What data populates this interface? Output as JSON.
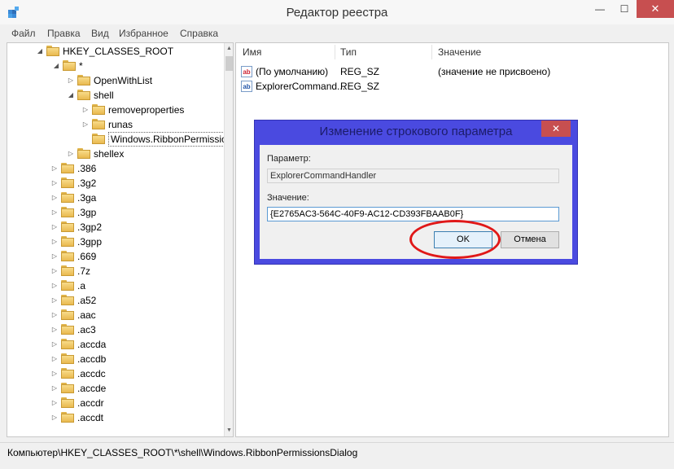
{
  "window": {
    "title": "Редактор реестра",
    "minimize_glyph": "—",
    "maximize_glyph": "☐",
    "close_glyph": "✕"
  },
  "menu": [
    "Файл",
    "Правка",
    "Вид",
    "Избранное",
    "Справка"
  ],
  "tree": [
    {
      "label": "HKEY_CLASSES_ROOT",
      "expanded": true
    },
    {
      "label": "*",
      "expanded": true
    },
    {
      "label": "OpenWithList",
      "expanded": false
    },
    {
      "label": "shell",
      "expanded": true
    },
    {
      "label": "removeproperties",
      "expanded": false
    },
    {
      "label": "runas",
      "expanded": false
    },
    {
      "label": "Windows.RibbonPermissionsDialog",
      "selected": true
    },
    {
      "label": "shellex",
      "expanded": false
    },
    {
      "label": ".386"
    },
    {
      "label": ".3g2"
    },
    {
      "label": ".3ga"
    },
    {
      "label": ".3gp"
    },
    {
      "label": ".3gp2"
    },
    {
      "label": ".3gpp"
    },
    {
      "label": ".669"
    },
    {
      "label": ".7z"
    },
    {
      "label": ".a"
    },
    {
      "label": ".a52"
    },
    {
      "label": ".aac"
    },
    {
      "label": ".ac3"
    },
    {
      "label": ".accda"
    },
    {
      "label": ".accdb"
    },
    {
      "label": ".accdc"
    },
    {
      "label": ".accde"
    },
    {
      "label": ".accdr"
    },
    {
      "label": ".accdt"
    }
  ],
  "list": {
    "columns": [
      "Имя",
      "Тип",
      "Значение"
    ],
    "rows": [
      {
        "icon": "string-value-icon",
        "icon_text": "ab",
        "name": "(По умолчанию)",
        "type": "REG_SZ",
        "value": "(значение не присвоено)"
      },
      {
        "icon": "string-value-icon",
        "icon_text": "ab",
        "name": "ExplorerCommand...",
        "type": "REG_SZ",
        "value": ""
      }
    ]
  },
  "status": "Компьютер\\HKEY_CLASSES_ROOT\\*\\shell\\Windows.RibbonPermissionsDialog",
  "dialog": {
    "title": "Изменение строкового параметра",
    "close_glyph": "✕",
    "param_label": "Параметр:",
    "param_value": "ExplorerCommandHandler",
    "value_label": "Значение:",
    "value_text": "{E2765AC3-564C-40F9-AC12-CD393FBAAB0F}",
    "ok_label": "OK",
    "cancel_label": "Отмена"
  },
  "colors": {
    "dialog_frame": "#4a4ae0",
    "close_red": "#c74f50",
    "highlight_circle": "#e01818"
  }
}
